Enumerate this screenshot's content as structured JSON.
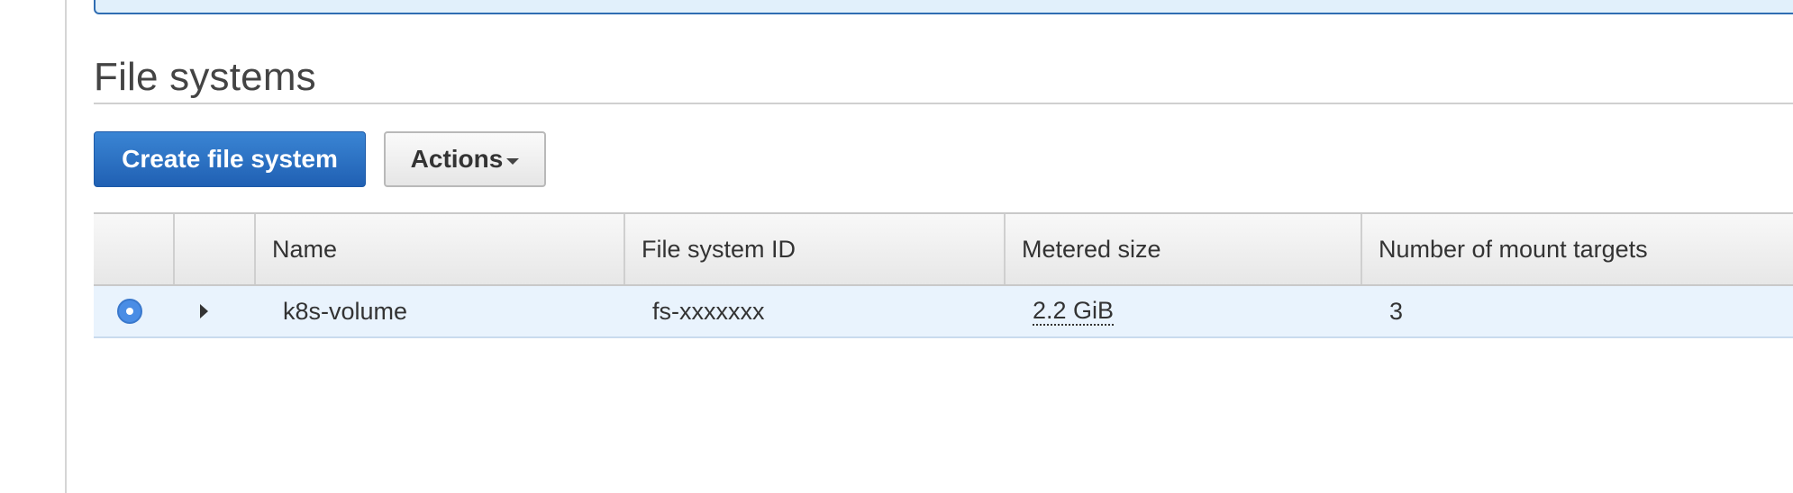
{
  "section": {
    "title": "File systems"
  },
  "toolbar": {
    "create_label": "Create file system",
    "actions_label": "Actions"
  },
  "table": {
    "columns": [
      "",
      "",
      "Name",
      "File system ID",
      "Metered size",
      "Number of mount targets"
    ],
    "rows": [
      {
        "selected": true,
        "name": "k8s-volume",
        "file_system_id": "fs-xxxxxxx",
        "metered_size": "2.2 GiB",
        "mount_targets": "3"
      }
    ]
  },
  "colors": {
    "primary_button": "#2a6ec4",
    "selected_row": "#e9f3fd",
    "banner_border": "#2f6db2",
    "banner_fill": "#e1f0fb"
  },
  "icons": {
    "radio": "radio-selected-icon",
    "expand": "caret-right-icon",
    "dropdown": "caret-down-icon"
  }
}
